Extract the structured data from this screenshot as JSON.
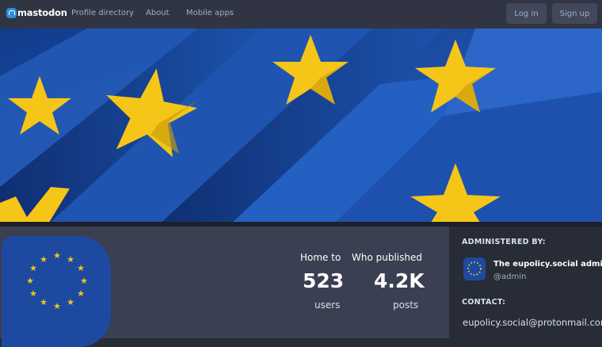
{
  "topbar": {
    "logo_text": "mastodon",
    "nav": [
      "Profile directory",
      "About",
      "Mobile apps"
    ],
    "login_label": "Log in",
    "signup_label": "Sign up"
  },
  "stats": {
    "home_to": "Home to",
    "users_count": "523",
    "users_label": "users",
    "who_published": "Who published",
    "posts_count": "4.2K",
    "posts_label": "posts"
  },
  "sidebar": {
    "administered_by": "ADMINISTERED BY:",
    "admin_name": "The eupolicy.social admin",
    "admin_handle": "@admin",
    "contact_title": "CONTACT:",
    "contact_email": "eupolicy.social@protonmail.com"
  },
  "colors": {
    "flag_blue": "#1e4fa6",
    "star_yellow": "#f5c518",
    "topbar": "#313543",
    "panel": "#3a3f51"
  }
}
